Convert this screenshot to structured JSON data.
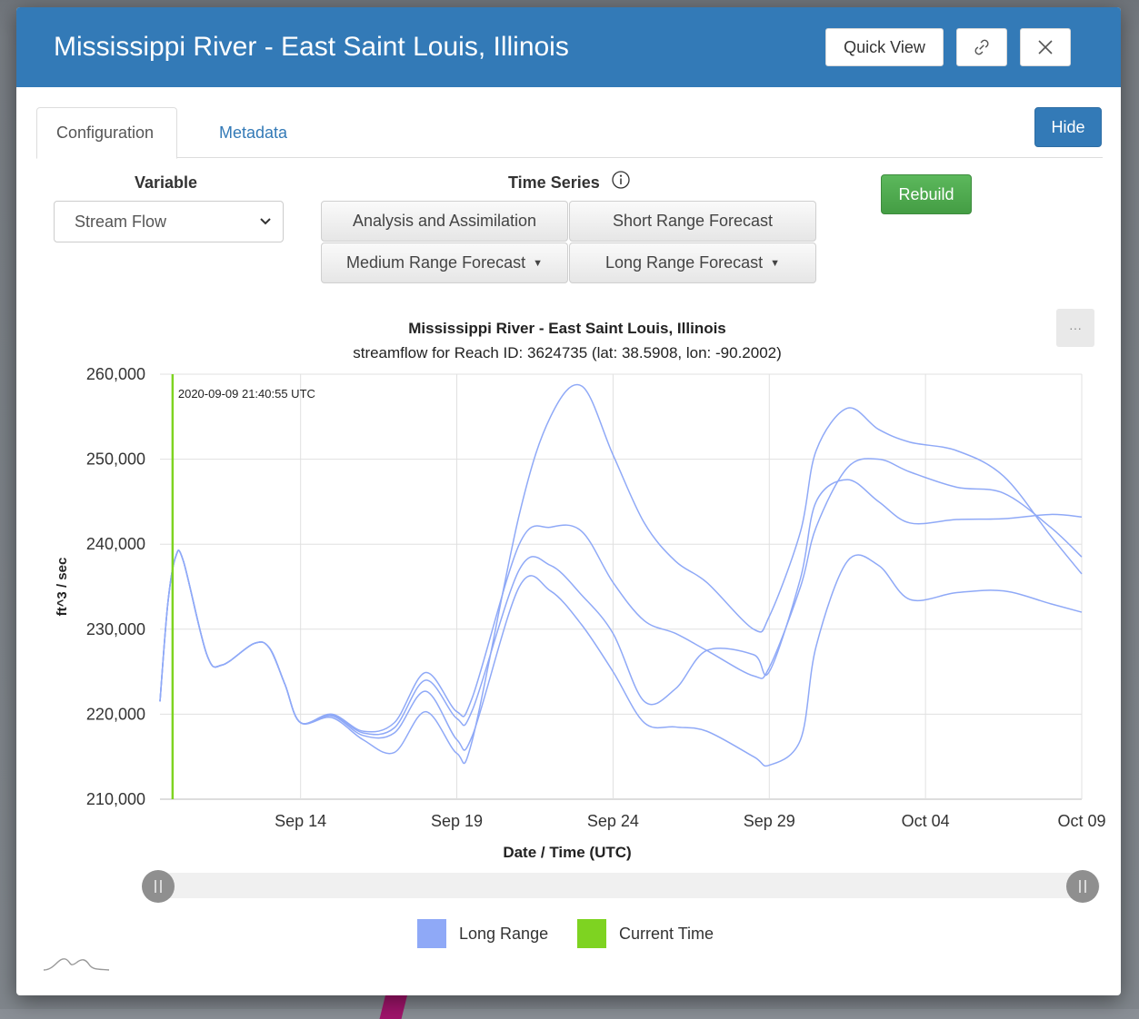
{
  "modal": {
    "title": "Mississippi River - East Saint Louis, Illinois",
    "quick_view_label": "Quick View",
    "link_icon": "link-icon",
    "close_icon": "close-icon"
  },
  "tabs": [
    {
      "label": "Configuration",
      "active": true
    },
    {
      "label": "Metadata",
      "active": false
    }
  ],
  "hide_label": "Hide",
  "variable": {
    "label": "Variable",
    "selected": "Stream Flow"
  },
  "time_series": {
    "label": "Time Series",
    "info_icon": "info-icon",
    "buttons": [
      "Analysis and Assimilation",
      "Short Range Forecast",
      "Medium Range Forecast",
      "Long Range Forecast"
    ]
  },
  "rebuild_label": "Rebuild",
  "chart_menu_label": "···",
  "colors": {
    "header_blue": "#337ab7",
    "long_range": "#8fa9f7",
    "current_time": "#7ed321",
    "rebuild_green": "#5cb85c"
  },
  "chart_data": {
    "type": "line",
    "title": "Mississippi River - East Saint Louis, Illinois",
    "subtitle": "streamflow for Reach ID: 3624735 (lat: 38.5908, lon: -90.2002)",
    "xlabel": "Date / Time (UTC)",
    "ylabel": "ft^3 / sec",
    "ylim": [
      210000,
      260000
    ],
    "xlim": [
      "2020-09-09 12:00",
      "2020-10-09 00:00"
    ],
    "y_ticks": [
      "260,000",
      "250,000",
      "240,000",
      "230,000",
      "220,000",
      "210,000"
    ],
    "x_ticks": [
      "Sep 14",
      "Sep 19",
      "Sep 24",
      "Sep 29",
      "Oct 04",
      "Oct 09"
    ],
    "grid": true,
    "current_time_label": "2020-09-09 21:40:55 UTC",
    "current_time": "2020-09-09 21:40:55",
    "legend": [
      "Long Range",
      "Current Time"
    ],
    "legend_position": "bottom",
    "series": [
      {
        "name": "Long Range",
        "x": [
          "2020-09-09 12:00",
          "2020-09-09 18:00",
          "2020-09-10 00:00",
          "2020-09-10 06:00",
          "2020-09-11 00:00",
          "2020-09-11 12:00",
          "2020-09-12 12:00",
          "2020-09-13 00:00",
          "2020-09-13 12:00",
          "2020-09-14 00:00",
          "2020-09-15 00:00",
          "2020-09-16 00:00",
          "2020-09-17 00:00",
          "2020-09-18 00:00",
          "2020-09-19 00:00",
          "2020-09-19 12:00",
          "2020-09-21 00:00",
          "2020-09-22 00:00",
          "2020-09-23 00:00",
          "2020-09-24 00:00",
          "2020-09-25 00:00",
          "2020-09-26 00:00",
          "2020-09-27 00:00",
          "2020-09-28 12:00",
          "2020-09-29 00:00",
          "2020-09-30 00:00",
          "2020-09-30 12:00",
          "2020-10-01 12:00",
          "2020-10-02 12:00",
          "2020-10-03 12:00",
          "2020-10-05 00:00",
          "2020-10-06 12:00",
          "2020-10-08 00:00",
          "2020-10-09 00:00"
        ],
        "values": [
          221500,
          233000,
          238500,
          238000,
          227000,
          225800,
          228300,
          227800,
          223500,
          219000,
          220000,
          218000,
          219000,
          224900,
          220300,
          222000,
          240000,
          242000,
          241500,
          235500,
          231000,
          229500,
          227500,
          224500,
          225500,
          235000,
          242000,
          249000,
          250000,
          248500,
          246700,
          246000,
          242000,
          238500
        ]
      },
      {
        "name": "Long Range",
        "x": [
          "2020-09-09 12:00",
          "2020-09-09 18:00",
          "2020-09-10 00:00",
          "2020-09-10 06:00",
          "2020-09-11 00:00",
          "2020-09-11 12:00",
          "2020-09-12 12:00",
          "2020-09-13 00:00",
          "2020-09-13 12:00",
          "2020-09-14 00:00",
          "2020-09-15 00:00",
          "2020-09-16 00:00",
          "2020-09-17 00:00",
          "2020-09-18 00:00",
          "2020-09-19 00:00",
          "2020-09-19 12:00",
          "2020-09-21 00:00",
          "2020-09-22 00:00",
          "2020-09-23 00:00",
          "2020-09-24 00:00",
          "2020-09-25 00:00",
          "2020-09-26 00:00",
          "2020-09-27 00:00",
          "2020-09-28 12:00",
          "2020-09-29 00:00",
          "2020-09-30 00:00",
          "2020-09-30 12:00",
          "2020-10-01 12:00",
          "2020-10-02 12:00",
          "2020-10-03 12:00",
          "2020-10-05 00:00",
          "2020-10-06 12:00",
          "2020-10-08 00:00",
          "2020-10-09 00:00"
        ],
        "values": [
          221500,
          233000,
          238500,
          238000,
          227000,
          225800,
          228300,
          227800,
          223500,
          219000,
          219900,
          217800,
          218400,
          224000,
          219500,
          220500,
          237000,
          237500,
          234000,
          229500,
          221500,
          223000,
          227500,
          227000,
          225000,
          236000,
          245000,
          247600,
          245000,
          242500,
          242900,
          243000,
          243500,
          243200
        ]
      },
      {
        "name": "Long Range",
        "x": [
          "2020-09-09 12:00",
          "2020-09-09 18:00",
          "2020-09-10 00:00",
          "2020-09-10 06:00",
          "2020-09-11 00:00",
          "2020-09-11 12:00",
          "2020-09-12 12:00",
          "2020-09-13 00:00",
          "2020-09-13 12:00",
          "2020-09-14 00:00",
          "2020-09-15 00:00",
          "2020-09-16 00:00",
          "2020-09-17 00:00",
          "2020-09-18 00:00",
          "2020-09-19 00:00",
          "2020-09-19 12:00",
          "2020-09-21 00:00",
          "2020-09-22 00:00",
          "2020-09-23 00:00",
          "2020-09-24 00:00",
          "2020-09-25 00:00",
          "2020-09-26 00:00",
          "2020-09-27 00:00",
          "2020-09-28 12:00",
          "2020-09-29 00:00",
          "2020-09-30 00:00",
          "2020-09-30 12:00",
          "2020-10-01 12:00",
          "2020-10-02 12:00",
          "2020-10-03 12:00",
          "2020-10-05 00:00",
          "2020-10-06 12:00",
          "2020-10-08 00:00",
          "2020-10-09 00:00"
        ],
        "values": [
          221500,
          233000,
          238500,
          238000,
          227000,
          225800,
          228300,
          227800,
          223500,
          219000,
          219800,
          217500,
          217800,
          222700,
          217000,
          217500,
          235000,
          234500,
          230500,
          225000,
          219000,
          218500,
          218000,
          215000,
          214000,
          217000,
          228000,
          238000,
          237500,
          233500,
          234300,
          234500,
          233000,
          232000
        ]
      },
      {
        "name": "Long Range",
        "x": [
          "2020-09-09 12:00",
          "2020-09-09 18:00",
          "2020-09-10 00:00",
          "2020-09-10 06:00",
          "2020-09-11 00:00",
          "2020-09-11 12:00",
          "2020-09-12 12:00",
          "2020-09-13 00:00",
          "2020-09-13 12:00",
          "2020-09-14 00:00",
          "2020-09-15 00:00",
          "2020-09-16 00:00",
          "2020-09-17 00:00",
          "2020-09-18 00:00",
          "2020-09-19 00:00",
          "2020-09-19 12:00",
          "2020-09-21 00:00",
          "2020-09-22 00:00",
          "2020-09-23 00:00",
          "2020-09-24 00:00",
          "2020-09-25 00:00",
          "2020-09-26 00:00",
          "2020-09-27 00:00",
          "2020-09-28 12:00",
          "2020-09-29 00:00",
          "2020-09-30 00:00",
          "2020-09-30 12:00",
          "2020-10-01 12:00",
          "2020-10-02 12:00",
          "2020-10-03 12:00",
          "2020-10-05 00:00",
          "2020-10-06 12:00",
          "2020-10-08 00:00",
          "2020-10-09 00:00"
        ],
        "values": [
          221500,
          233000,
          238500,
          238000,
          227000,
          225800,
          228300,
          227800,
          223500,
          219000,
          219600,
          217000,
          215500,
          220300,
          215400,
          217000,
          243500,
          255000,
          258600,
          250500,
          242500,
          238000,
          235500,
          230000,
          231500,
          241500,
          251000,
          256000,
          253500,
          252000,
          251000,
          248000,
          241000,
          236500
        ]
      }
    ]
  }
}
